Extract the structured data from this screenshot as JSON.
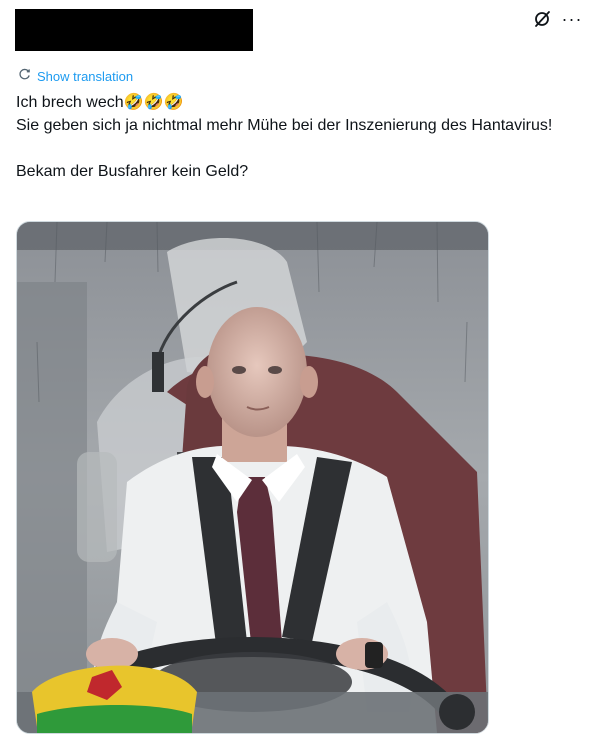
{
  "post": {
    "show_translation": "Show translation",
    "lines": [
      "Ich brech wech🤣🤣🤣",
      "Sie geben sich ja nichtmal mehr Mühe bei der Inszenierung des Hantavirus!",
      "",
      "Bekam der Busfahrer kein Geld?"
    ]
  },
  "icons": {
    "grok": "grok-icon",
    "more": "more-options-icon",
    "translate": "translate-icon"
  },
  "colors": {
    "link": "#1d9bf0",
    "text": "#0f1419"
  }
}
